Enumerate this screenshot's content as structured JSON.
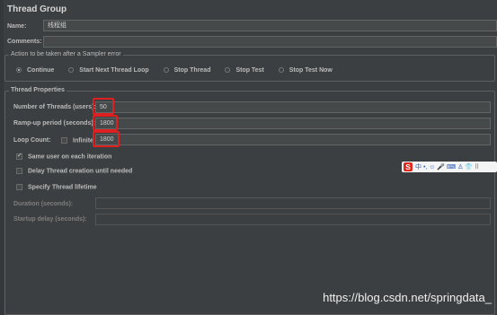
{
  "title": "Thread Group",
  "name": {
    "label": "Name:",
    "value": "线程组"
  },
  "comments": {
    "label": "Comments:",
    "value": ""
  },
  "sampler_error": {
    "legend": "Action to be taken after a Sampler error",
    "options": [
      "Continue",
      "Start Next Thread Loop",
      "Stop Thread",
      "Stop Test",
      "Stop Test Now"
    ],
    "selected": "Continue"
  },
  "properties": {
    "heading": "Thread Properties",
    "threads": {
      "label": "Number of Threads (users):",
      "value": "50"
    },
    "rampup": {
      "label": "Ramp-up period (seconds):",
      "value": "1800"
    },
    "loop": {
      "label": "Loop Count:",
      "infinite_label": "Infinite",
      "value": "1800"
    },
    "same_user": "Same user on each iteration",
    "delay_creation": "Delay Thread creation until needed",
    "specify_lifetime": "Specify Thread lifetime",
    "duration": {
      "label": "Duration (seconds):",
      "value": ""
    },
    "startup_delay": {
      "label": "Startup delay (seconds):",
      "value": ""
    }
  },
  "ime": {
    "logo": "S",
    "text": "中 •, ☺ 🎤 ⌨ ♙ 👕 ⠿"
  },
  "watermark": "https://blog.csdn.net/springdata_"
}
